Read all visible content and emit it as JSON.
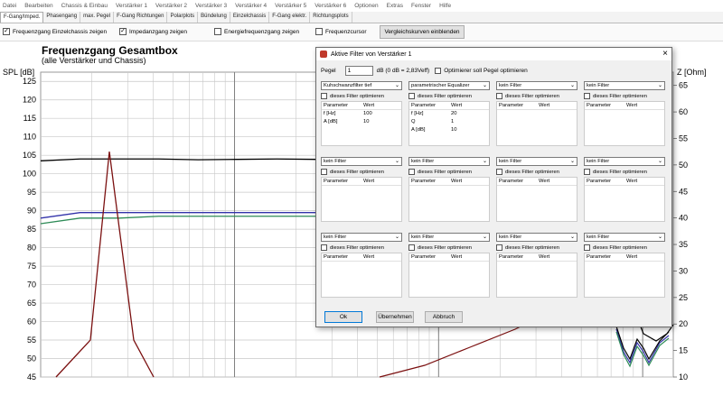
{
  "menu": [
    "Datei",
    "Bearbeiten",
    "Chassis & Einbau",
    "Verstärker 1",
    "Verstärker 2",
    "Verstärker 3",
    "Verstärker 4",
    "Verstärker 5",
    "Verstärker 6",
    "Optionen",
    "Extras",
    "Fenster",
    "Hilfe"
  ],
  "tabs": [
    "F-Gang/Imped.",
    "Phasengang",
    "max. Pegel",
    "F-Gang Richtungen",
    "Polarplots",
    "Bündelung",
    "Einzelchassis",
    "F-Gang elektr.",
    "Richtungsplots"
  ],
  "options": {
    "einzelchassis": {
      "label": "Frequenzgang Einzelchassis zeigen",
      "checked": true
    },
    "impedanz": {
      "label": "Impedanzgang zeigen",
      "checked": true
    },
    "energie": {
      "label": "Energiefrequenzgang zeigen",
      "checked": false
    },
    "cursor": {
      "label": "Frequenzcursor",
      "checked": false
    },
    "vergleich_button": "Vergleichskurven einblenden"
  },
  "chart": {
    "title": "Frequenzgang Gesamtbox",
    "subtitle": "(alle Verstärker und Chassis)",
    "ylabel_left": "SPL [dB]",
    "ylabel_right": "Z [Ohm]"
  },
  "chart_data": {
    "type": "line",
    "y_left_ticks": [
      125,
      120,
      115,
      110,
      105,
      100,
      95,
      90,
      85,
      80,
      75,
      70,
      65,
      60,
      55,
      50,
      45
    ],
    "y_right_ticks": [
      65,
      60,
      55,
      50,
      45,
      40,
      35,
      30,
      25,
      20,
      15,
      10
    ],
    "x_scale": "log",
    "grid": true,
    "series": [
      {
        "color": "#000000",
        "y_spl": [
          103.5,
          104,
          104,
          104,
          103.8,
          103.9,
          104,
          103.9
        ]
      },
      {
        "color": "#3333aa",
        "y_spl": [
          88,
          89.5,
          89.5,
          89.5,
          89.5,
          89.5,
          89.5,
          89.5
        ]
      },
      {
        "color": "#2e8b57",
        "y_spl": [
          86.5,
          88,
          88,
          88.5,
          88.5,
          88.5,
          88.5,
          88.5
        ]
      },
      {
        "color": "#7b1010",
        "y_spl": [
          45,
          55,
          106,
          55,
          45
        ]
      }
    ]
  },
  "dialog": {
    "title": "Aktive Filter von Verstärker 1",
    "close": "×",
    "pegel_label": "Pegel",
    "pegel_value": "1",
    "pegel_unit": "dB (0 dB = 2,83Veff)",
    "optimize_label": "Optimierer soll Pegel optimieren",
    "opt_label": "dieses Filter optimieren",
    "param_header": "Parameter",
    "value_header": "Wert",
    "filters": [
      {
        "type": "Kuhschwanzfilter tief",
        "params": [
          [
            "f [Hz]",
            "100"
          ],
          [
            "A [dB]",
            "10"
          ]
        ]
      },
      {
        "type": "parametrischer Equalizer",
        "params": [
          [
            "f [Hz]",
            "20"
          ],
          [
            "Q",
            "1"
          ],
          [
            "A [dB]",
            "10"
          ]
        ]
      },
      {
        "type": "kein Filter",
        "params": []
      },
      {
        "type": "kein Filter",
        "params": []
      },
      {
        "type": "kein Filter",
        "params": []
      },
      {
        "type": "kein Filter",
        "params": []
      },
      {
        "type": "kein Filter",
        "params": []
      },
      {
        "type": "kein Filter",
        "params": []
      },
      {
        "type": "kein Filter",
        "params": []
      },
      {
        "type": "kein Filter",
        "params": []
      },
      {
        "type": "kein Filter",
        "params": []
      },
      {
        "type": "kein Filter",
        "params": []
      }
    ],
    "buttons": {
      "ok": "Ok",
      "apply": "Übernehmen",
      "cancel": "Abbruch"
    }
  }
}
